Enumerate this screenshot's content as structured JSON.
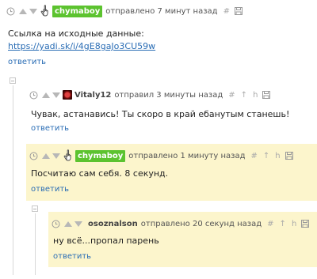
{
  "comments": [
    {
      "user": "chymaboy",
      "posted": "отправлено 7 минут назад",
      "text": "Ссылка на исходные данные:",
      "link": "https://yadi.sk/i/4gE8gaJo3CU59w",
      "reply": "ответить"
    },
    {
      "user": "Vitaly12",
      "posted": "отправил 3 минуты назад",
      "text": "Чувак, астанавись! Ты скоро в край ебанутым станешь!",
      "reply": "ответить"
    },
    {
      "user": "chymaboy",
      "posted": "отправлено 1 минуту назад",
      "text": "Посчитаю сам себя. 8 секунд.",
      "reply": "ответить"
    },
    {
      "user": "osoznalson",
      "posted": "отправлено 20 секунд назад",
      "text": "ну всё...пропал парень",
      "reply": "ответить"
    }
  ],
  "tools": {
    "hash": "#",
    "up": "↑",
    "parent": "h"
  },
  "icons": [
    "clock-icon",
    "vote-up-icon",
    "vote-down-icon",
    "hand-icon",
    "save-icon",
    "avatar-icon",
    "collapse-icon"
  ],
  "colors": {
    "user_badge": "#5cc32f",
    "link": "#2a6db5",
    "highlight_bg": "#fcf5cc"
  }
}
